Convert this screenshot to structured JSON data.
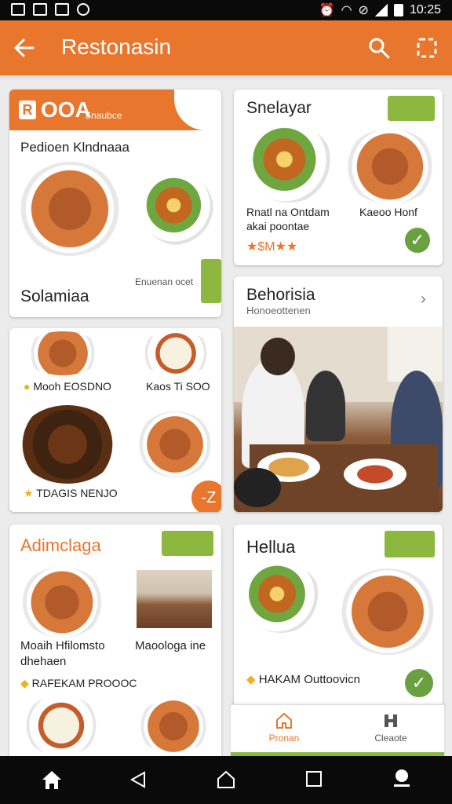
{
  "status_bar": {
    "time": "10:25"
  },
  "app_bar": {
    "title": "Restonasin",
    "back_icon": "arrow-left-icon",
    "search_icon": "search-icon",
    "menu_icon": "grid-icon",
    "color": "#e8762c"
  },
  "cards": {
    "c1": {
      "brand": "OOA",
      "brand_small": "Snaubce",
      "subtitle": "Pedioen Klndnaaa",
      "footer_title": "Solamiaa",
      "footer_small": "Enuenan ocet"
    },
    "c2": {
      "title": "Snelayar",
      "left_label_1": "Rnatl na Ontdam",
      "left_label_2": "akai poontae",
      "right_label": "Kaeoo Honf",
      "stars": "★$M★★"
    },
    "c3": {
      "label_1": "Mooh EOSDNO",
      "label_2": "Kaos Ti SOO",
      "label_3": "TDAGIS NENJO",
      "fab": "-Z"
    },
    "c4": {
      "title": "Behorisia",
      "subtitle": "Honoeottenen"
    },
    "c5": {
      "title": "Adimclaga",
      "label_left_1": "Moaih Hfilomsto",
      "label_left_2": "dhehaen",
      "label_right": "Maoologa ine",
      "footer": "RAFEKAM PROOOC"
    },
    "c6": {
      "title": "Hellua",
      "footer": "HAKAM Outtoovicn"
    }
  },
  "bottom_nav": {
    "items": [
      {
        "label": "Pronan",
        "icon": "home-outline-icon",
        "active": true
      },
      {
        "label": "Cleaote",
        "icon": "tools-icon",
        "active": false
      }
    ]
  },
  "accent_colors": {
    "orange": "#e8762c",
    "green": "#8cb840"
  }
}
